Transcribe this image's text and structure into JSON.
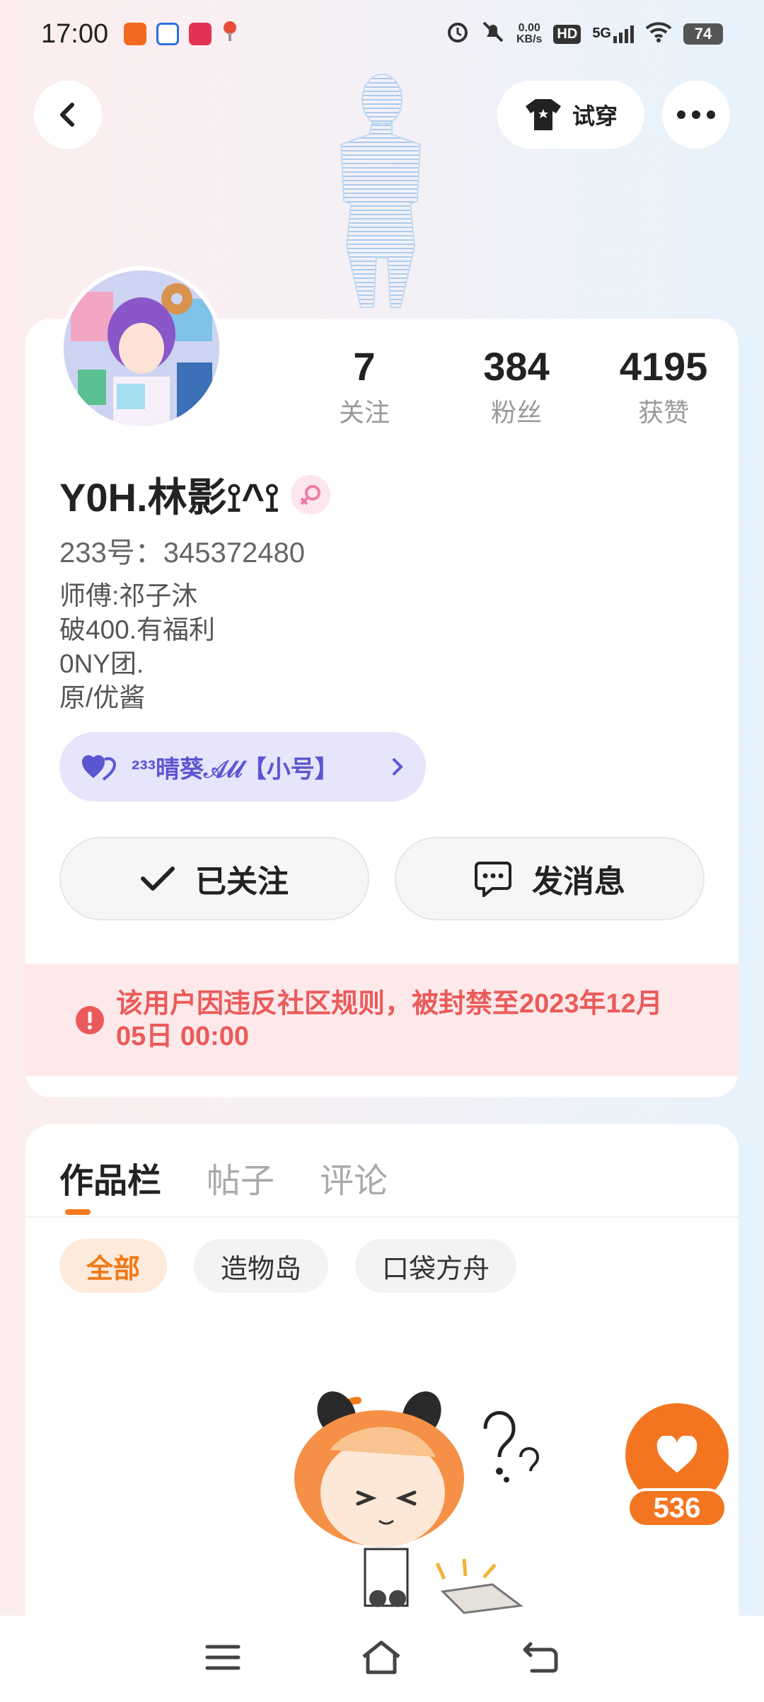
{
  "status_bar": {
    "time": "17:00",
    "net_speed_value": "0.00",
    "net_speed_unit": "KB/s",
    "hd_label": "HD",
    "signal_label": "5G",
    "battery": "74"
  },
  "header": {
    "try_on_label": "试穿"
  },
  "profile": {
    "stats": [
      {
        "value": "7",
        "label": "关注"
      },
      {
        "value": "384",
        "label": "粉丝"
      },
      {
        "value": "4195",
        "label": "获赞"
      }
    ],
    "name": "Y0H.林影⟟^⟟",
    "uid": "233号：345372480",
    "bio": [
      "师傅:祁子沐",
      "破400.有福利",
      "0NY团.",
      "原/优酱"
    ],
    "alt_account": "²³³晴葵𝒜𝓁𝓁【小号】",
    "follow_button": "已关注",
    "message_button": "发消息",
    "ban_notice": "该用户因违反社区规则，被封禁至2023年12月05日 00:00"
  },
  "works": {
    "tabs": [
      "作品栏",
      "帖子",
      "评论"
    ],
    "active_tab": 0,
    "chips": [
      "全部",
      "造物岛",
      "口袋方舟"
    ],
    "active_chip": 0
  },
  "like_fab": {
    "count": "536"
  },
  "colors": {
    "accent": "#f4751f",
    "ban_text": "#eb5a5a",
    "alt_account": "#5c55d2"
  }
}
